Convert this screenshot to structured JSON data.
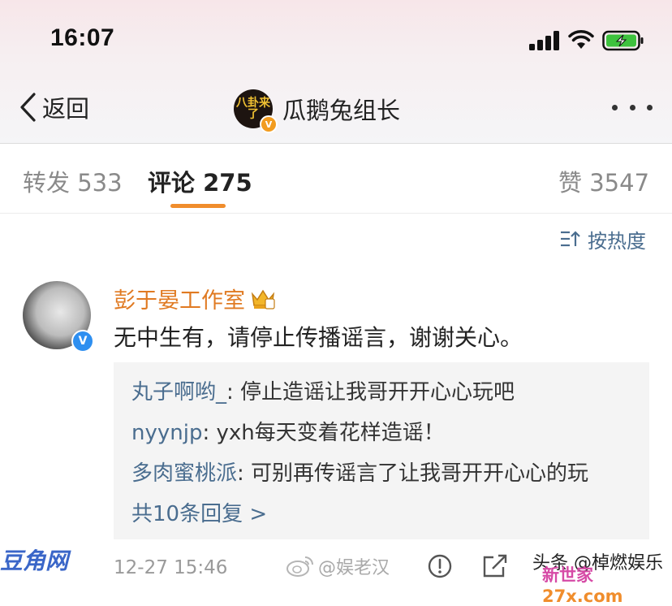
{
  "status_bar": {
    "time": "16:07"
  },
  "nav": {
    "back_label": "返回",
    "title": "瓜鹅兔组长",
    "avatar_text": "八卦来了"
  },
  "tabs": [
    {
      "label": "转发",
      "count": "533"
    },
    {
      "label": "评论",
      "count": "275"
    },
    {
      "label": "赞",
      "count": "3547"
    }
  ],
  "sort_label": "按热度",
  "comment": {
    "author": "彭于晏工作室",
    "text": "无中生有，请停止传播谣言，谢谢关心。",
    "time": "12-27 15:46",
    "replies": [
      {
        "name": "丸子啊哟_",
        "text": ": 停止造谣让我哥开开心心玩吧"
      },
      {
        "name": "nyynjp",
        "text": ": yxh每天变着花样造谣！"
      },
      {
        "name": "多肉蜜桃派",
        "text": ": 可别再传谣言了让我哥开开心心的玩"
      }
    ],
    "more_replies": "共10条回复 >"
  },
  "watermarks": {
    "weibo": "@娱老汉",
    "douban": "豆角网",
    "toutiao": "头条 @棹燃娱乐",
    "site_a": "新世家",
    "site_b": "27x.com"
  },
  "colors": {
    "accent": "#f08d2c",
    "link": "#4a6d8f",
    "author": "#e07a22",
    "verified_blue": "#2e8ff0"
  },
  "icons": [
    "signal-icon",
    "wifi-icon",
    "battery-charging-icon",
    "back-chevron-icon",
    "more-icon",
    "sort-icon",
    "crown-icon",
    "report-icon",
    "share-icon",
    "weibo-logo"
  ]
}
